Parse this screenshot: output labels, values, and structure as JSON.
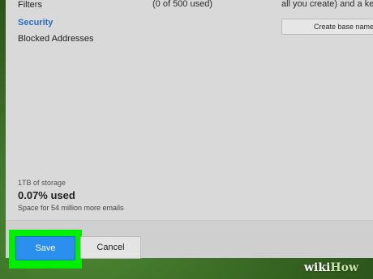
{
  "sidebar": {
    "items": [
      {
        "label": "Filters"
      },
      {
        "label": "Security"
      },
      {
        "label": "Blocked Addresses"
      }
    ]
  },
  "filters": {
    "usage": "(0 of 500 used)"
  },
  "base_name": {
    "text": "all you create) and a key",
    "button_label": "Create base name"
  },
  "storage": {
    "capacity": "1TB of storage",
    "percent_used": "0.07% used",
    "remaining": "Space for 54 million more emails"
  },
  "footer": {
    "save_label": "Save",
    "cancel_label": "Cancel"
  },
  "watermark": {
    "wiki": "wiki",
    "how": "How"
  },
  "colors": {
    "accent": "#2b8fee",
    "highlight": "#00ee00",
    "active_nav": "#2a6ebd"
  }
}
